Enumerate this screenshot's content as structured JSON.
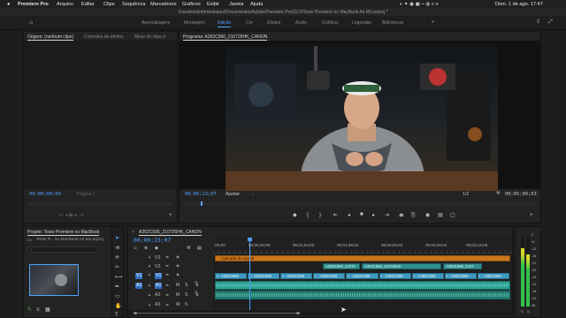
{
  "menubar": {
    "app": "Premiere Pro",
    "items": [
      "Arquivo",
      "Editar",
      "Clipe",
      "Sequência",
      "Marcadores",
      "Gráficos",
      "Exibir",
      "Janela",
      "Ajuda"
    ],
    "clock": "Dom. 1 de ago.  17:47"
  },
  "window_title": "/Usuários/infomeduquis/Documentos/Adobe/Premiere Pro/15.0/Teste Premiere no MacBook Air M1.prproj *",
  "workspaces": [
    "Aprendizagem",
    "Montagem",
    "Edição",
    "Cor",
    "Efeitos",
    "Áudio",
    "Gráficos",
    "Legendas",
    "Bibliotecas"
  ],
  "active_workspace": "Edição",
  "source_panel": {
    "tabs": [
      "Origem: (nenhum clipe)",
      "Controles de efeitos",
      "Mixer de clipe d"
    ],
    "timecode": "00;00;00;00",
    "page": "Página 1"
  },
  "program_panel": {
    "title": "Programa: A352C566_210726HK_CANON",
    "timecode": "00;00;23;07",
    "fit": "Ajustar",
    "ratio": "1/2",
    "duration": "00;05;00;03"
  },
  "project_panel": {
    "title": "Projeto: Teste Premiere no MacBook",
    "file": "Teste P... no MacBook Air M1.prproj"
  },
  "timeline": {
    "sequence": "A352C566_210726HK_CANON",
    "timecode": "00;00;23;07",
    "ruler": [
      ":00;00",
      "00;00;32;00",
      "00;01;04;02",
      "00;01;36;02",
      "00;02;08;04",
      "00;02;40;04",
      "00;03;12;06"
    ],
    "video_tracks": [
      "V3",
      "V2",
      "V1"
    ],
    "audio_tracks": [
      "A1",
      "A2",
      "A3"
    ],
    "v3_clip": "Camada de ajuste",
    "v2_clips": [
      "A352C566_21072",
      "A352C566_210726HK",
      "A352C566_2107"
    ],
    "v1_clip_label": "A352C566",
    "playhead_fraction": 0.12
  },
  "meter": {
    "scale": [
      "0",
      "-6",
      "-12",
      "-18",
      "-24",
      "-30",
      "-36",
      "-42",
      "-48",
      "-54",
      "dB"
    ],
    "level_left": 0.82,
    "level_right": 0.74
  },
  "colors": {
    "accent": "#4fa3ff",
    "video_clip": "#3f9ac0",
    "audio_clip": "#2a9d8f",
    "adjustment_layer": "#c8751b",
    "v2_clip": "#2f8e8e"
  }
}
